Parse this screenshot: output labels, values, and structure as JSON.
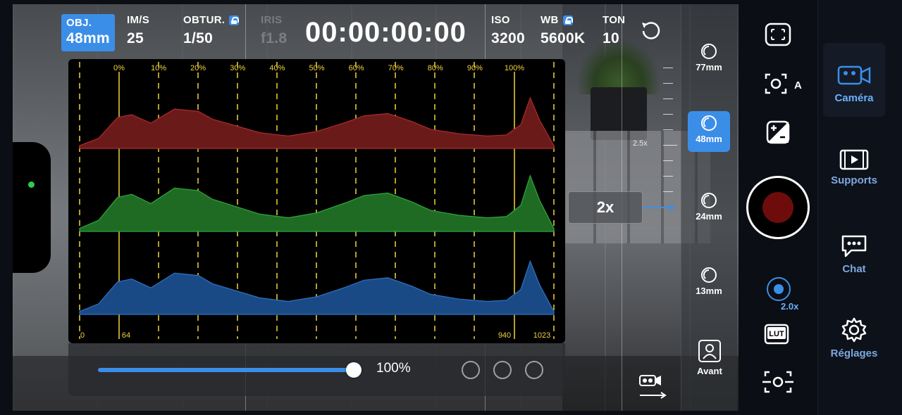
{
  "top_bar": {
    "lens": {
      "label": "OBJ.",
      "value": "48mm"
    },
    "fps": {
      "label": "IM/S",
      "value": "25"
    },
    "shutter": {
      "label": "OBTUR.",
      "value": "1/50"
    },
    "iris": {
      "label": "IRIS",
      "value": "f1.8"
    },
    "timecode": "00:00:00:00",
    "iso": {
      "label": "ISO",
      "value": "3200"
    },
    "wb": {
      "label": "WB",
      "value": "5600K"
    },
    "tint": {
      "label": "TON",
      "value": "10"
    }
  },
  "histogram": {
    "percent_labels": [
      "0%",
      "10%",
      "20%",
      "30%",
      "40%",
      "50%",
      "60%",
      "70%",
      "80%",
      "90%",
      "100%"
    ],
    "code_labels": [
      "0",
      "64",
      "940",
      "1023"
    ],
    "channels": [
      {
        "name": "red",
        "color": "#6b1a1a",
        "stroke": "#b02a2a"
      },
      {
        "name": "green",
        "color": "#1f6b24",
        "stroke": "#2ea83a"
      },
      {
        "name": "blue",
        "color": "#1a4a86",
        "stroke": "#2e72c4"
      }
    ],
    "guide_color": "#f2d33a"
  },
  "opacity_slider": {
    "value": "100%",
    "fraction": 1.0
  },
  "zoom": {
    "badge": "2x",
    "scale_label": "2.5x"
  },
  "lenses": [
    {
      "label": "77mm",
      "active": false
    },
    {
      "label": "48mm",
      "active": true
    },
    {
      "label": "24mm",
      "active": false
    },
    {
      "label": "13mm",
      "active": false
    }
  ],
  "front_camera": {
    "label": "Avant"
  },
  "zoom_knob": {
    "label": "2.0x"
  },
  "nav": [
    {
      "label": "Caméra",
      "icon": "video-camera-icon",
      "active": true
    },
    {
      "label": "Supports",
      "icon": "film-icon",
      "active": false
    },
    {
      "label": "Chat",
      "icon": "chat-icon",
      "active": false
    },
    {
      "label": "Réglages",
      "icon": "gear-icon",
      "active": false
    }
  ],
  "colors": {
    "accent": "#3b8ee8",
    "record": "#6e0c0c",
    "status_dot": "#2ecc50"
  }
}
